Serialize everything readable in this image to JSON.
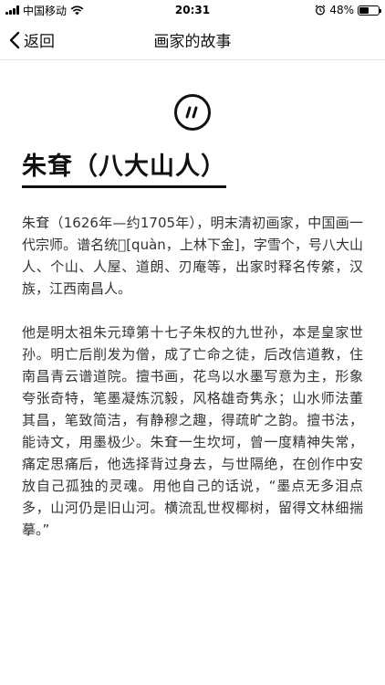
{
  "status_bar": {
    "carrier": "中国移动",
    "time": "20:31",
    "battery": "48%",
    "battery_level": 0.48
  },
  "nav": {
    "back_label": "返回",
    "title": "画家的故事"
  },
  "article": {
    "title": "朱耷（八大山人）",
    "paragraphs": [
      "朱耷（1626年—约1705年），明末清初画家，中国画一代宗师。谱名统𨨗[quàn，上林下金]，字雪个，号八大山人、个山、人屋、道朗、刃庵等，出家时释名传綮，汉族，江西南昌人。",
      "他是明太祖朱元璋第十七子朱权的九世孙，本是皇家世孙。明亡后削发为僧，成了亡命之徒，后改信道教，住南昌青云谱道院。擅书画，花鸟以水墨写意为主，形象夸张奇特，笔墨凝炼沉毅，风格雄奇隽永；山水师法董其昌，笔致简洁，有静穆之趣，得疏旷之韵。擅书法，能诗文，用墨极少。朱耷一生坎坷，曾一度精神失常，痛定思痛后，他选择背过身去，与世隔绝，在创作中安放自己孤独的灵魂。用他自己的话说，“墨点无多泪点多，山河仍是旧山河。横流乱世杈椰树，留得文林细揣摹。”"
    ]
  }
}
